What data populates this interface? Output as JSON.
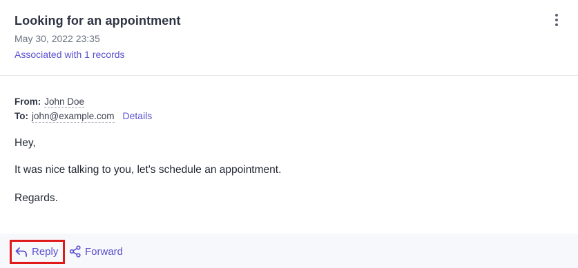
{
  "email": {
    "subject": "Looking for an appointment",
    "date": "May 30, 2022 23:35",
    "associated": "Associated with 1 records",
    "from_label": "From:",
    "from_value": "John Doe",
    "to_label": "To:",
    "to_value": "john@example.com",
    "details_label": "Details",
    "body": {
      "greeting": "Hey,",
      "line1": "It was nice talking to you, let's schedule an appointment.",
      "closing": "Regards."
    }
  },
  "actions": {
    "reply_label": "Reply",
    "forward_label": "Forward",
    "more_icon": "more-vertical-icon",
    "reply_icon": "reply-arrow-icon",
    "forward_icon": "share-icon"
  },
  "colors": {
    "accent": "#5a4fcf",
    "highlight_border": "#e01a1a",
    "footer_bg": "#f7f8fb"
  }
}
